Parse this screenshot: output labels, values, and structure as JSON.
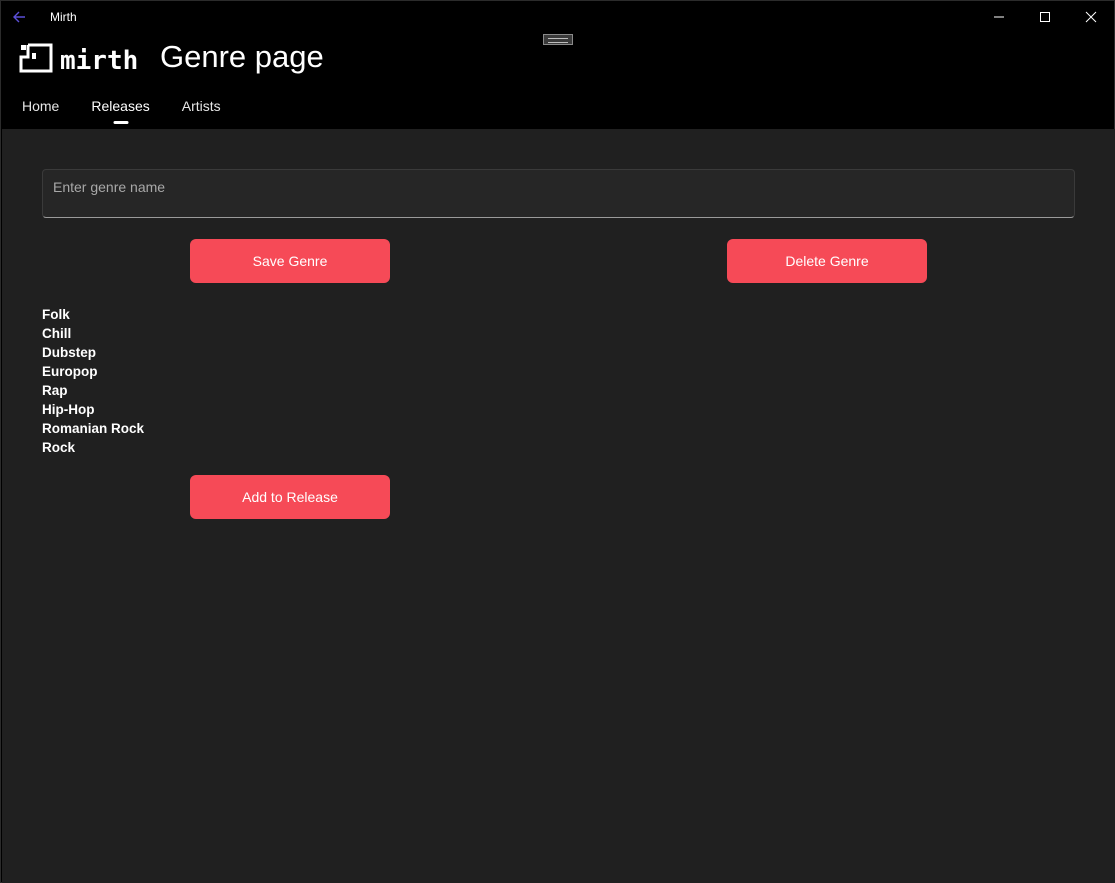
{
  "window": {
    "title": "Mirth"
  },
  "header": {
    "logo_text": "mirth",
    "page_title": "Genre page"
  },
  "nav": {
    "items": [
      {
        "label": "Home",
        "active": false
      },
      {
        "label": "Releases",
        "active": true
      },
      {
        "label": "Artists",
        "active": false
      }
    ]
  },
  "form": {
    "genre_input_placeholder": "Enter genre name",
    "genre_input_value": "",
    "save_label": "Save Genre",
    "delete_label": "Delete Genre",
    "add_label": "Add to Release"
  },
  "genres": [
    "Folk",
    "Chill",
    "Dubstep",
    "Europop",
    "Rap",
    "Hip-Hop",
    "Romanian Rock",
    "Rock"
  ],
  "icons": {
    "back": "back-arrow-icon",
    "minimize": "minimize-icon",
    "maximize": "maximize-icon",
    "close": "close-icon",
    "logo": "mirth-logo-icon"
  },
  "colors": {
    "accent": "#f64a57",
    "background": "#202020",
    "header": "#000000",
    "back_arrow": "#5b4fd8"
  }
}
